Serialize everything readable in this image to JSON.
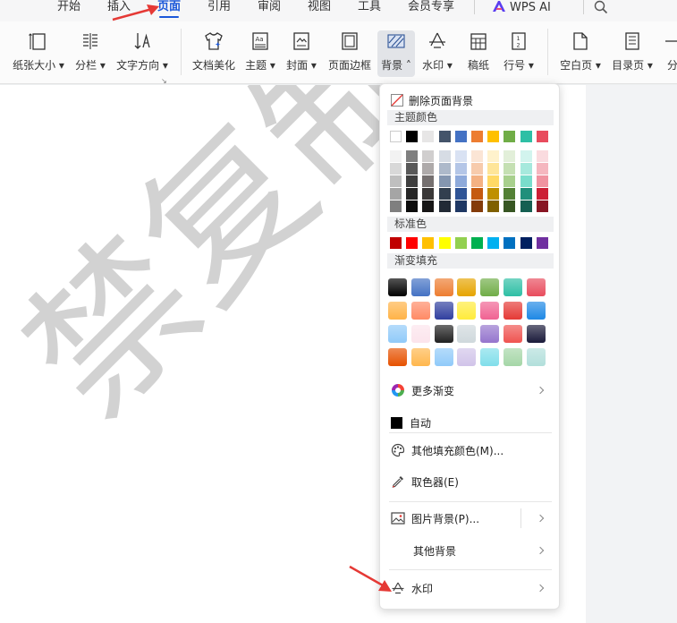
{
  "menubar": {
    "tabs": [
      {
        "label": "开始"
      },
      {
        "label": "插入"
      },
      {
        "label": "页面",
        "active": true
      },
      {
        "label": "引用"
      },
      {
        "label": "审阅"
      },
      {
        "label": "视图"
      },
      {
        "label": "工具"
      },
      {
        "label": "会员专享"
      },
      {
        "label": "WPS AI"
      }
    ]
  },
  "ribbon": {
    "paper_size": "纸张大小",
    "columns": "分栏",
    "text_direction": "文字方向",
    "doc_beautify": "文档美化",
    "theme": "主题",
    "cover": "封面",
    "page_border": "页面边框",
    "background": "背景",
    "watermark": "水印",
    "manuscript": "稿纸",
    "line_number": "行号",
    "blank_page": "空白页",
    "toc_page": "目录页",
    "section_break": "分"
  },
  "document": {
    "watermark_text": "禁复制"
  },
  "dropdown": {
    "delete_bg": "删除页面背景",
    "theme_colors_title": "主题颜色",
    "standard_colors_title": "标准色",
    "gradient_title": "渐变填充",
    "more_gradients": "更多渐变",
    "auto": "自动",
    "other_fill": "其他填充颜色(M)...",
    "eyedropper": "取色器(E)",
    "picture_bg": "图片背景(P)...",
    "other_bg": "其他背景",
    "watermark": "水印",
    "theme_row": [
      "#ffffff",
      "#000000",
      "#e7e6e6",
      "#44546a",
      "#4472c4",
      "#ed7d31",
      "#ffc000",
      "#70ad47",
      "#2ebfa5",
      "#e84c5d"
    ],
    "theme_shades": [
      [
        "#f2f2f2",
        "#7f7f7f",
        "#d0cece",
        "#d6dce4",
        "#d9e2f3",
        "#fbe5d5",
        "#fff2cc",
        "#e2efd9",
        "#d2f4ee",
        "#fadbdf"
      ],
      [
        "#d8d8d8",
        "#595959",
        "#aeaaaa",
        "#adb9ca",
        "#b4c6e7",
        "#f7cbac",
        "#fee599",
        "#c5e0b3",
        "#a6e9dd",
        "#f5b7bf"
      ],
      [
        "#bfbfbf",
        "#3f3f3f",
        "#757070",
        "#8496b0",
        "#8eaadb",
        "#f4b183",
        "#ffd965",
        "#a8d08d",
        "#79ddcc",
        "#f093a0"
      ],
      [
        "#a5a5a5",
        "#262626",
        "#3a3838",
        "#323f4f",
        "#2f5496",
        "#c55a11",
        "#bf9000",
        "#538135",
        "#1f8f7b",
        "#cc1f35"
      ],
      [
        "#7f7f7f",
        "#0c0c0c",
        "#171616",
        "#222a35",
        "#1f3864",
        "#843c0b",
        "#7f6000",
        "#375623",
        "#155f52",
        "#881523"
      ]
    ],
    "standard_colors": [
      "#c00000",
      "#ff0000",
      "#ffc000",
      "#ffff00",
      "#92d050",
      "#00b050",
      "#00b0f0",
      "#0070c0",
      "#002060",
      "#7030a0"
    ],
    "gradients": [
      [
        "#000000",
        "#4472c4",
        "#ed7d31",
        "#e6a400",
        "#70ad47",
        "#2ebfa5",
        "#e84c5d"
      ],
      [
        "#ffb347",
        "#ff8a65",
        "#303f9f",
        "#ffeb3b",
        "#f06292",
        "#e53935",
        "#1e88e5"
      ],
      [
        "#90caf9",
        "#fce4ec",
        "#212121",
        "#cfd8dc",
        "#9575cd",
        "#ef5350",
        "#1a1a3a"
      ],
      [
        "#e65100",
        "#ffb74d",
        "#90caf9",
        "#d1c4e9",
        "#80deea",
        "#a5d6a7",
        "#b2dfdb"
      ]
    ]
  }
}
